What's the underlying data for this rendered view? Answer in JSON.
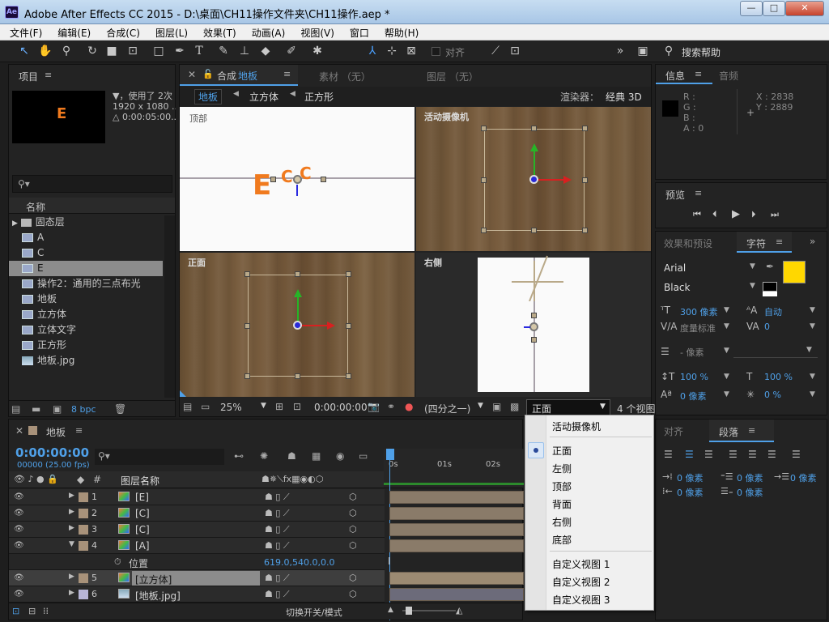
{
  "window": {
    "title": "Adobe After Effects CC 2015 - D:\\桌面\\CH11操作文件夹\\CH11操作.aep *",
    "min": "—",
    "max": "□",
    "close": "✕"
  },
  "menu": [
    "文件(F)",
    "编辑(E)",
    "合成(C)",
    "图层(L)",
    "效果(T)",
    "动画(A)",
    "视图(V)",
    "窗口",
    "帮助(H)"
  ],
  "toolbar": {
    "align_label": "对齐",
    "search_help": "搜索帮助"
  },
  "project": {
    "tab": "项目",
    "thumb_letter": "E",
    "info": [
      "▼，使用了 2次",
      "1920 x 1080 ...",
      "△ 0:00:05:00..."
    ],
    "search_placeholder": "",
    "col_name": "名称",
    "items": [
      {
        "label": "固态层",
        "kind": "folder"
      },
      {
        "label": "A",
        "kind": "comp"
      },
      {
        "label": "C",
        "kind": "comp"
      },
      {
        "label": "E",
        "kind": "comp",
        "selected": true
      },
      {
        "label": "操作2：通用的三点布光",
        "kind": "comp"
      },
      {
        "label": "地板",
        "kind": "comp"
      },
      {
        "label": "立方体",
        "kind": "comp"
      },
      {
        "label": "立体文字",
        "kind": "comp"
      },
      {
        "label": "正方形",
        "kind": "comp"
      },
      {
        "label": "地板.jpg",
        "kind": "image"
      }
    ],
    "bpc": "8 bpc"
  },
  "comp_panel": {
    "tab_prefix": "合成",
    "tab_name": "地板",
    "tab_footage": "素材 （无）",
    "tab_layer": "图层 （无）",
    "breadcrumbs": [
      "地板",
      "立方体",
      "正方形"
    ],
    "renderer_label": "渲染器：",
    "renderer": "经典 3D",
    "views": {
      "tl": "顶部",
      "tr": "活动摄像机",
      "bl": "正面",
      "br": "右侧"
    },
    "zoom": "25%",
    "timecode": "0:00:00:00",
    "resolution": "(四分之一)",
    "view_select": "正面",
    "layout": "4 个视图"
  },
  "view_menu": {
    "items": [
      "活动摄像机",
      "正面",
      "左侧",
      "顶部",
      "背面",
      "右侧",
      "底部",
      "自定义视图 1",
      "自定义视图 2",
      "自定义视图 3"
    ],
    "selected": "正面"
  },
  "info": {
    "tab": "信息",
    "tab2": "音频",
    "r": "R :",
    "g": "G :",
    "b": "B :",
    "a": "A : 0",
    "x": "X : 2838",
    "y": "Y : 2889"
  },
  "preview": {
    "tab": "预览"
  },
  "character": {
    "tab1": "效果和预设",
    "tab2": "字符",
    "font": "Arial",
    "style": "Black",
    "size": "300 像素",
    "leading": "自动",
    "kerning": "度量标准",
    "tracking": "0",
    "stroke": "- 像素",
    "vscale": "100 %",
    "hscale": "100 %",
    "baseline": "0 像素",
    "tsume": "0 %",
    "fill_color": "#ffd700"
  },
  "paragraph": {
    "tab1": "对齐",
    "tab2": "段落",
    "indent": [
      "0 像素",
      "0 像素",
      "0 像素",
      "0 像素",
      "0 像素"
    ]
  },
  "timeline": {
    "tab": "地板",
    "timecode": "0:00:00:00",
    "fps": "00000 (25.00 fps)",
    "col_num": "#",
    "col_name": "图层名称",
    "ticks": [
      "0s",
      "01s",
      "02s"
    ],
    "toggle_label": "切换开关/模式",
    "layers": [
      {
        "num": "1",
        "name": "[E]",
        "color": "#a8927a"
      },
      {
        "num": "2",
        "name": "[C]",
        "color": "#a8927a"
      },
      {
        "num": "3",
        "name": "[C]",
        "color": "#a8927a"
      },
      {
        "num": "4",
        "name": "[A]",
        "color": "#a8927a"
      }
    ],
    "position_label": "位置",
    "position_value": "619.0,540.0,0.0",
    "layer5": {
      "num": "5",
      "name": "[立方体]"
    },
    "layer6": {
      "num": "6",
      "name": "[地板.jpg]"
    }
  }
}
